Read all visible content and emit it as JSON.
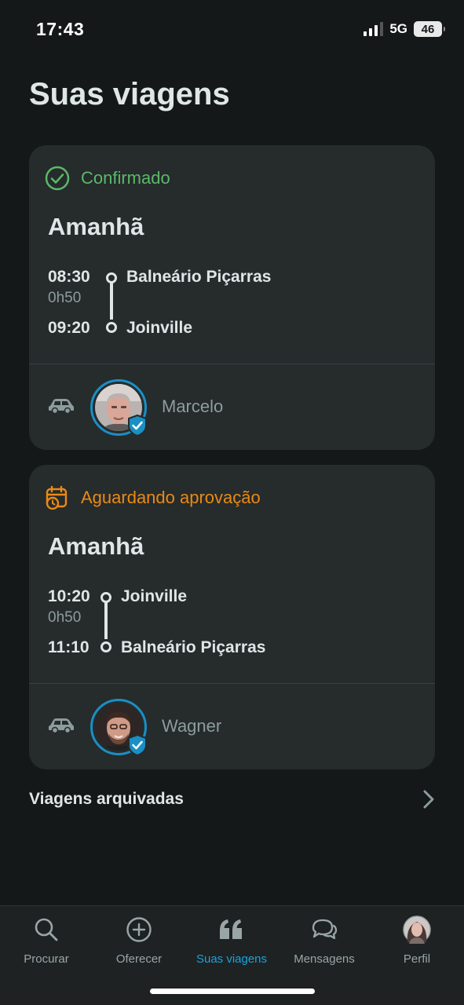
{
  "status_bar": {
    "time": "17:43",
    "network": "5G",
    "battery": "46"
  },
  "page": {
    "title": "Suas viagens"
  },
  "trips": [
    {
      "status": "Confirmado",
      "status_kind": "confirmed",
      "day": "Amanhã",
      "departure_time": "08:30",
      "duration": "0h50",
      "arrival_time": "09:20",
      "origin": "Balneário Piçarras",
      "destination": "Joinville",
      "driver": {
        "name": "Marcelo",
        "verified": true
      }
    },
    {
      "status": "Aguardando aprovação",
      "status_kind": "pending",
      "day": "Amanhã",
      "departure_time": "10:20",
      "duration": "0h50",
      "arrival_time": "11:10",
      "origin": "Joinville",
      "destination": "Balneário Piçarras",
      "driver": {
        "name": "Wagner",
        "verified": true
      }
    }
  ],
  "archived": {
    "label": "Viagens arquivadas"
  },
  "tab_bar": {
    "tabs": [
      {
        "label": "Procurar",
        "icon": "search-icon",
        "active": false
      },
      {
        "label": "Oferecer",
        "icon": "plus-circle-icon",
        "active": false
      },
      {
        "label": "Suas viagens",
        "icon": "quote-icon",
        "active": true
      },
      {
        "label": "Mensagens",
        "icon": "chat-bubbles-icon",
        "active": false
      },
      {
        "label": "Perfil",
        "icon": "profile-avatar-icon",
        "active": false
      }
    ]
  },
  "colors": {
    "background": "#151818",
    "card": "#262b2c",
    "confirmed": "#5bb86a",
    "pending": "#e98a15",
    "accent": "#1aa3dd",
    "muted": "#8d9c9c"
  }
}
